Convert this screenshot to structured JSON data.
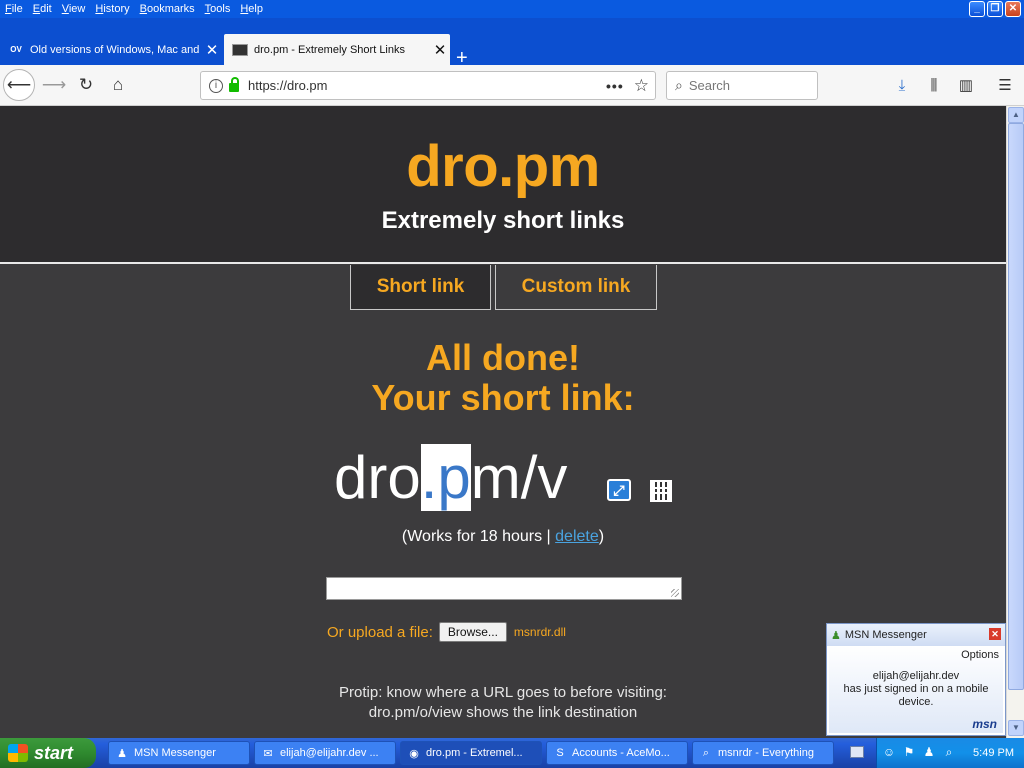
{
  "menu": [
    "File",
    "Edit",
    "View",
    "History",
    "Bookmarks",
    "Tools",
    "Help"
  ],
  "tabs": [
    {
      "favicon": "OV",
      "title": "Old versions of Windows, Mac and",
      "close": "✕"
    },
    {
      "favicon": "",
      "title": "dro.pm - Extremely Short Links",
      "close": "✕"
    }
  ],
  "newtab": "+",
  "nav": {
    "url": "https://dro.pm",
    "page_actions": "•••",
    "search_placeholder": "Search"
  },
  "page": {
    "brand": "dro.pm",
    "tagline": "Extremely short links",
    "tabs": [
      {
        "label": "Short link",
        "active": true
      },
      {
        "label": "Custom link",
        "active": false
      }
    ],
    "done_line1": "All done!",
    "done_line2": "Your short link:",
    "link_pre": "dro",
    "link_sel": ".p",
    "link_post": "m/v",
    "works_pre": "(Works for 18 hours | ",
    "works_link": "delete",
    "works_post": ")",
    "upload_label": "Or upload a file:",
    "browse": "Browse...",
    "file_name": "msnrdr.dll",
    "protip_line1": "Protip: know where a URL goes to before visiting:",
    "protip_line2": "dro.pm/o/view shows the link destination"
  },
  "msn": {
    "title": "MSN Messenger",
    "options": "Options",
    "user": "elijah@elijahr.dev",
    "line2": "has just signed in on a mobile",
    "line3": "device.",
    "logo": "msn"
  },
  "taskbar": {
    "start": "start",
    "items": [
      {
        "label": "MSN Messenger",
        "icon": "msn-icon"
      },
      {
        "label": "elijah@elijahr.dev ...",
        "icon": "chat-icon"
      },
      {
        "label": "dro.pm - Extremel...",
        "icon": "firefox-icon",
        "active": true
      },
      {
        "label": "Accounts - AceMo...",
        "icon": "s-icon"
      },
      {
        "label": "msnrdr - Everything",
        "icon": "search-icon"
      }
    ],
    "clock": "5:49 PM"
  },
  "colors": {
    "accent": "#f6a821",
    "page_bg": "#3c3b3d",
    "hero_bg": "#2d2c2e",
    "link": "#4aa3e0"
  }
}
